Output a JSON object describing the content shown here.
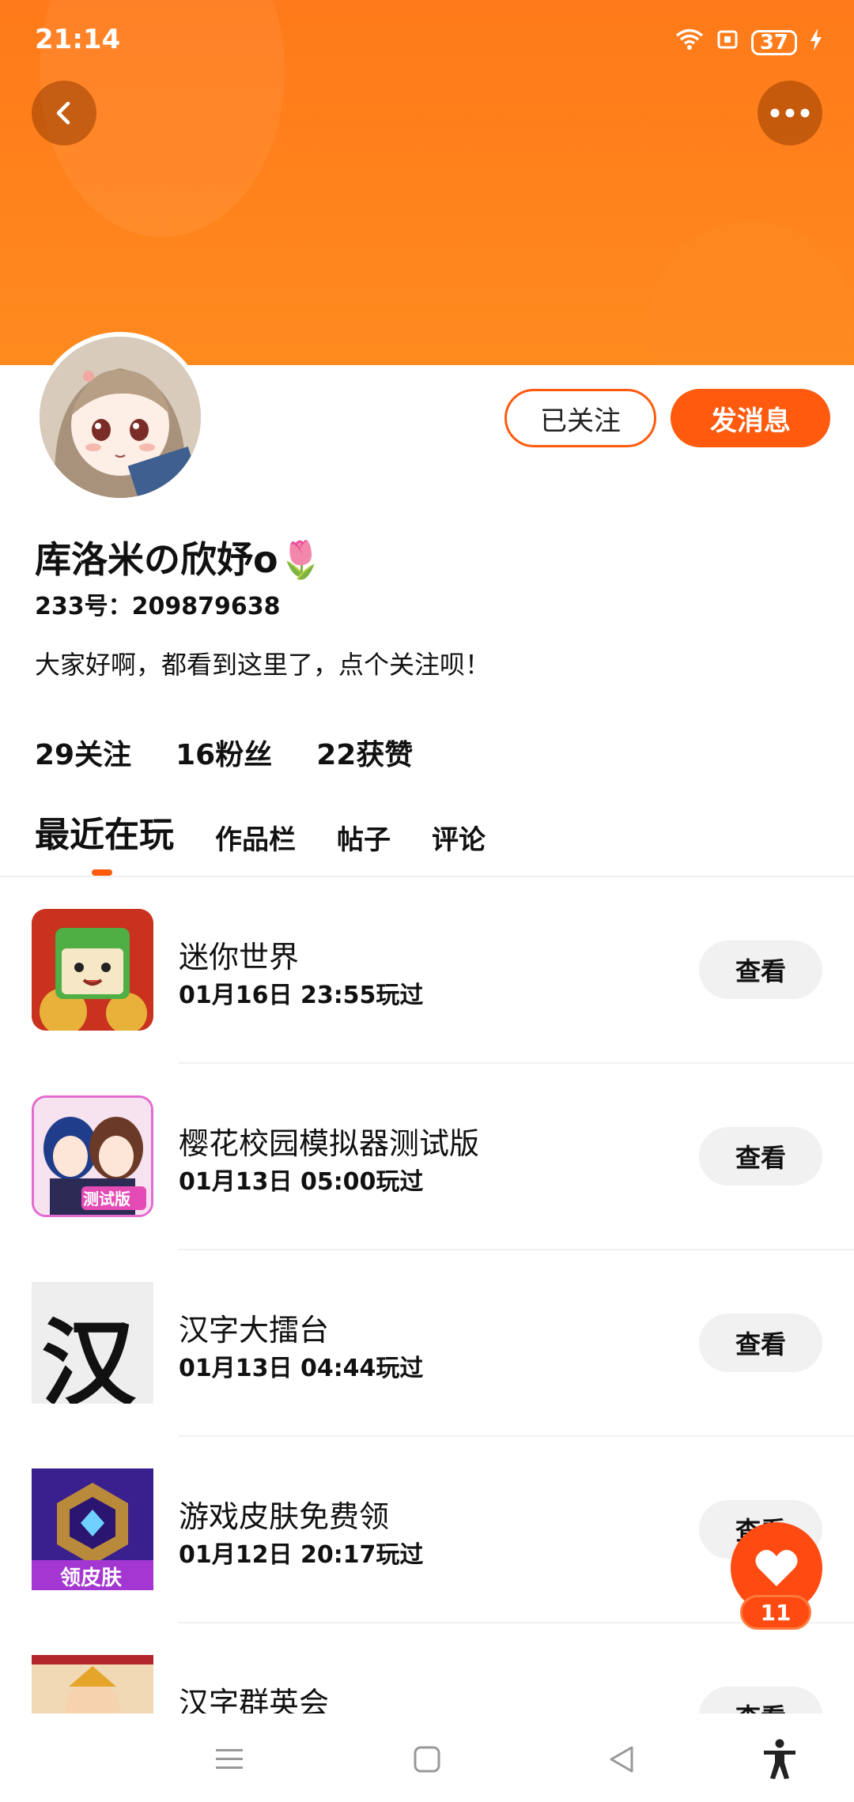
{
  "status_bar": {
    "time": "21:14",
    "battery": "37"
  },
  "profile": {
    "username": "库洛米の欣妤o🌷",
    "user_id": "233号：209879638",
    "bio": "大家好啊，都看到这里了，点个关注呗！",
    "followed_label": "已关注",
    "message_label": "发消息",
    "stats": {
      "following": "29关注",
      "fans": "16粉丝",
      "likes": "22获赞"
    }
  },
  "tabs": [
    {
      "label": "最近在玩",
      "active": true
    },
    {
      "label": "作品栏",
      "active": false
    },
    {
      "label": "帖子",
      "active": false
    },
    {
      "label": "评论",
      "active": false
    }
  ],
  "games": [
    {
      "name": "迷你世界",
      "meta": "01月16日 23:55玩过",
      "button": "查看"
    },
    {
      "name": "樱花校园模拟器测试版",
      "meta": "01月13日 05:00玩过",
      "button": "查看",
      "icon_badge": "测试版"
    },
    {
      "name": "汉字大擂台",
      "meta": "01月13日 04:44玩过",
      "button": "查看",
      "icon_text": "汉"
    },
    {
      "name": "游戏皮肤免费领",
      "meta": "01月12日 20:17玩过",
      "button": "查看",
      "icon_badge": "领皮肤"
    },
    {
      "name": "汉字群英会",
      "meta": "",
      "button": "查看"
    }
  ],
  "fab": {
    "count": "11"
  },
  "colors": {
    "accent": "#ff5a0d",
    "banner": "#ff7a1a"
  }
}
